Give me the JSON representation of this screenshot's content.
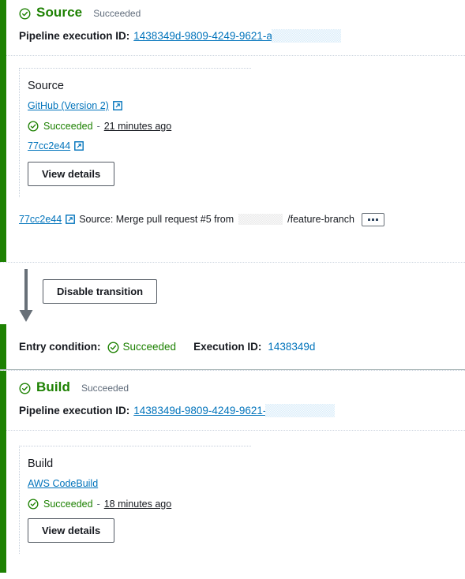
{
  "colors": {
    "stage_accent": "#1d8102",
    "success_green": "#1d8102",
    "link_blue": "#0073bb",
    "text_dark": "#16191f",
    "muted": "#5f6b7a"
  },
  "source_stage": {
    "status_icon": "check-circle-icon",
    "title": "Source",
    "status": "Succeeded",
    "execution": {
      "label": "Pipeline execution ID:",
      "id": "1438349d-9809-4249-9621-a",
      "redacted": true
    },
    "action": {
      "name": "Source",
      "provider": "GitHub (Version 2)",
      "provider_icon": "external-link-icon",
      "status": "Succeeded",
      "separator": "-",
      "time": "21 minutes ago",
      "commit": "77cc2e44",
      "commit_icon": "external-link-icon",
      "button": "View details"
    },
    "revision": {
      "commit": "77cc2e44",
      "commit_icon": "external-link-icon",
      "message_before": "Source: Merge pull request #5 from",
      "message_after": "/feature-branch",
      "menu_icon": "ellipsis-icon"
    }
  },
  "transition": {
    "arrow_icon": "down-arrow-icon",
    "button": "Disable transition"
  },
  "entry_condition": {
    "label": "Entry condition:",
    "status_icon": "check-circle-icon",
    "status": "Succeeded",
    "execution_label": "Execution ID:",
    "execution_id": "1438349d"
  },
  "build_stage": {
    "status_icon": "check-circle-icon",
    "title": "Build",
    "status": "Succeeded",
    "execution": {
      "label": "Pipeline execution ID:",
      "id": "1438349d-9809-4249-9621-",
      "redacted": true
    },
    "action": {
      "name": "Build",
      "provider": "AWS CodeBuild",
      "status": "Succeeded",
      "separator": "-",
      "time": "18 minutes ago",
      "button": "View details"
    }
  }
}
